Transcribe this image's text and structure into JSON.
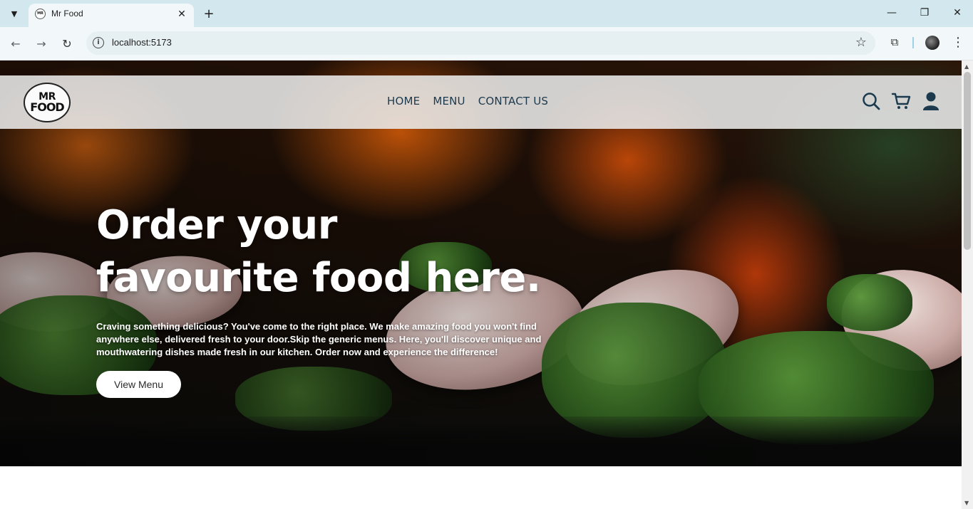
{
  "browser": {
    "tab_title": "Mr Food",
    "url": "localhost:5173",
    "icons": {
      "tab_list": "chevron-down-icon",
      "new_tab": "plus-icon",
      "minimize": "minimize-icon",
      "restore": "restore-icon",
      "close": "close-icon",
      "back": "back-arrow-icon",
      "forward": "forward-arrow-icon",
      "reload": "reload-icon",
      "site_info": "info-icon",
      "bookmark": "star-icon",
      "extensions": "puzzle-icon",
      "profile": "profile-avatar-icon",
      "menu": "kebab-menu-icon"
    }
  },
  "site": {
    "logo": {
      "line1": "MR",
      "line2": "FOOD"
    },
    "nav": [
      {
        "label": "HOME"
      },
      {
        "label": "MENU"
      },
      {
        "label": "CONTACT US"
      }
    ],
    "nav_icons": [
      "search-icon",
      "cart-icon",
      "user-icon"
    ],
    "nav_color": "#1c3a4e"
  },
  "hero": {
    "title_line1": "Order your",
    "title_line2": "favourite food here.",
    "description": "Craving something delicious? You've come to the right place. We make amazing food you won't find anywhere else, delivered fresh to your door.Skip the generic menus. Here, you'll discover unique and mouthwatering dishes made fresh in our kitchen. Order now and experience the difference!",
    "cta_label": "View Menu"
  }
}
